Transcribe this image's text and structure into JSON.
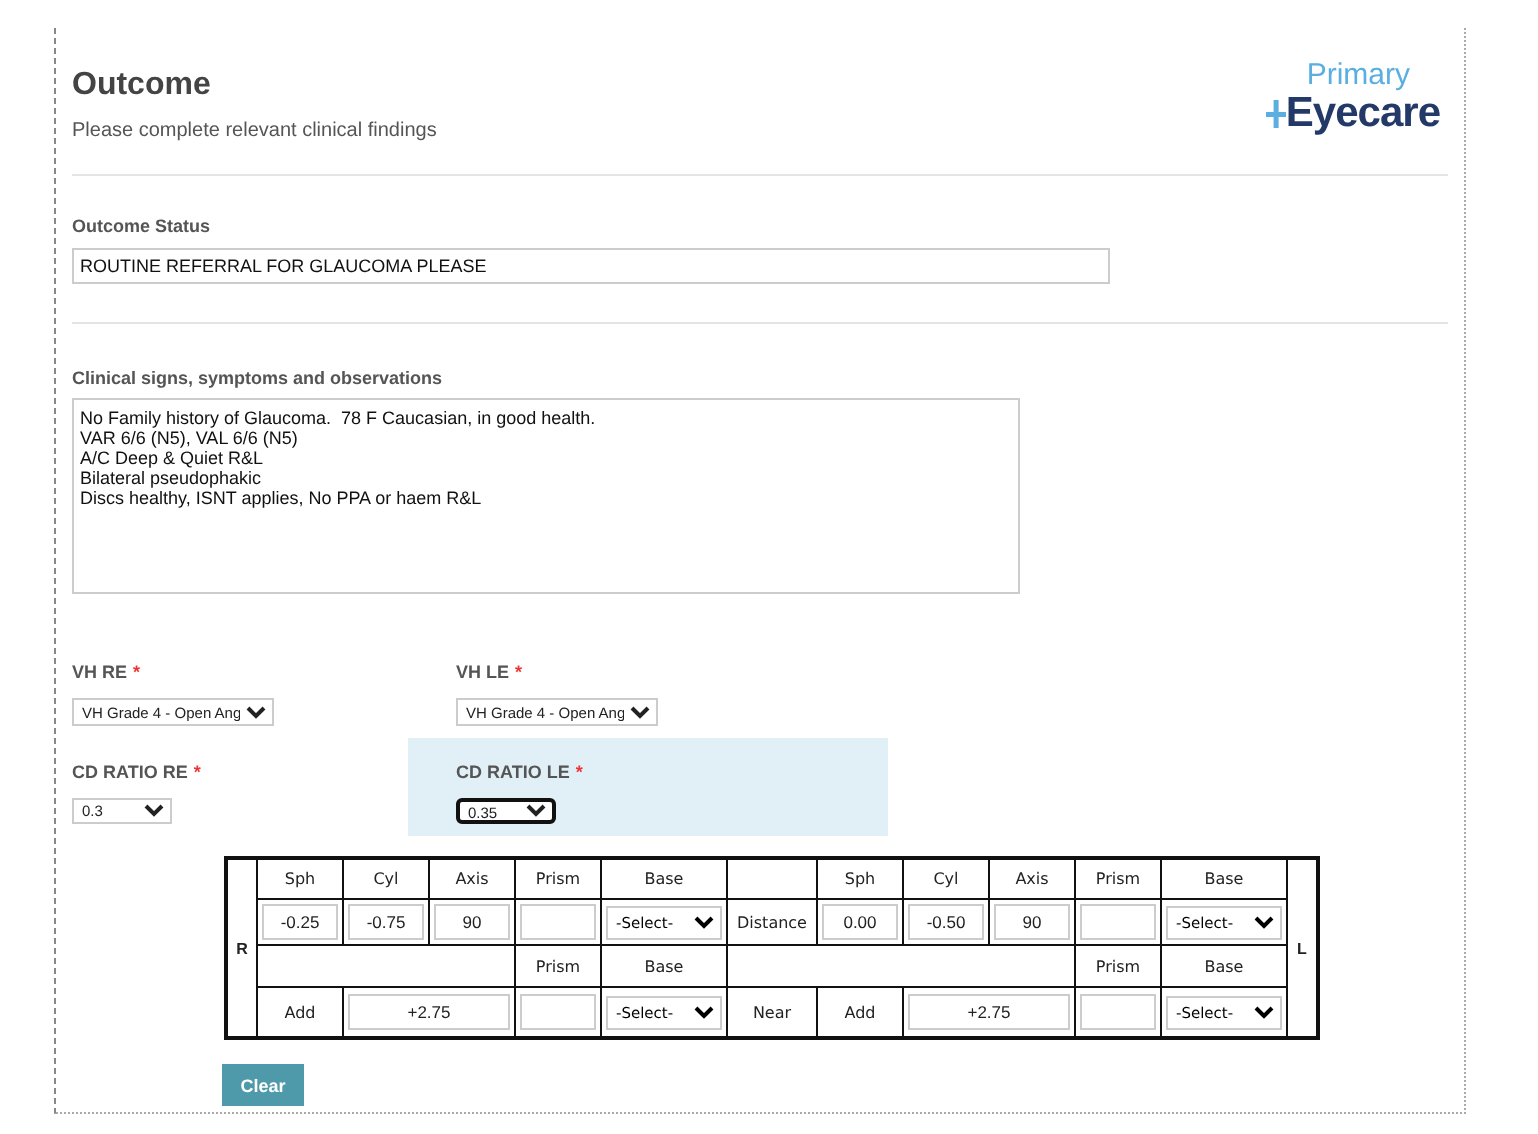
{
  "header": {
    "title": "Outcome",
    "subtitle": "Please complete relevant clinical findings"
  },
  "logo": {
    "top": "Primary",
    "bottom": "Eyecare"
  },
  "outcome_status": {
    "label": "Outcome Status",
    "value": "ROUTINE REFERRAL FOR GLAUCOMA PLEASE"
  },
  "clinical_notes": {
    "label": "Clinical signs, symptoms and observations",
    "lines": [
      "No Family history of Glaucoma.  78 F Caucasian, in good health.",
      "VAR 6/6 (N5), VAL 6/6 (N5)",
      "A/C Deep & Quiet R&L",
      "Bilateral pseudophakic",
      "Discs healthy, ISNT applies, No PPA or haem R&L"
    ]
  },
  "selects": [
    {
      "label": "VH RE",
      "required_mark": "*",
      "value": "VH Grade 4 - Open Ang",
      "highlighted": false,
      "focused": false
    },
    {
      "label": "VH LE",
      "required_mark": "*",
      "value": "VH Grade 4 - Open Ang",
      "highlighted": false,
      "focused": false
    },
    {
      "label": "CD RATIO RE",
      "required_mark": "*",
      "value": "0.3",
      "highlighted": false,
      "focused": false
    },
    {
      "label": "CD RATIO LE",
      "required_mark": "*",
      "value": "0.35",
      "highlighted": true,
      "focused": true
    }
  ],
  "prescription": {
    "right_label": "R",
    "left_label": "L",
    "right_headers": [
      "Sph",
      "Cyl",
      "Axis",
      "Prism",
      "Base"
    ],
    "left_headers": [
      "Sph",
      "Cyl",
      "Axis",
      "Prism",
      "Base"
    ],
    "right_sub_headers": [
      "Prism",
      "Base"
    ],
    "left_sub_headers": [
      "Prism",
      "Base"
    ],
    "distance_label": "Distance",
    "near_label": "Near",
    "right": {
      "sph": "-0.25",
      "cyl": "-0.75",
      "axis": "90",
      "base": "-Select-",
      "add_label": "Add",
      "add": "+2.75",
      "near_base": "-Select-"
    },
    "left": {
      "sph": "0.00",
      "cyl": "-0.50",
      "axis": "90",
      "base": "-Select-",
      "add_label": "Add",
      "add": "+2.75",
      "near_base": "-Select-"
    }
  },
  "clear_button": "Clear"
}
